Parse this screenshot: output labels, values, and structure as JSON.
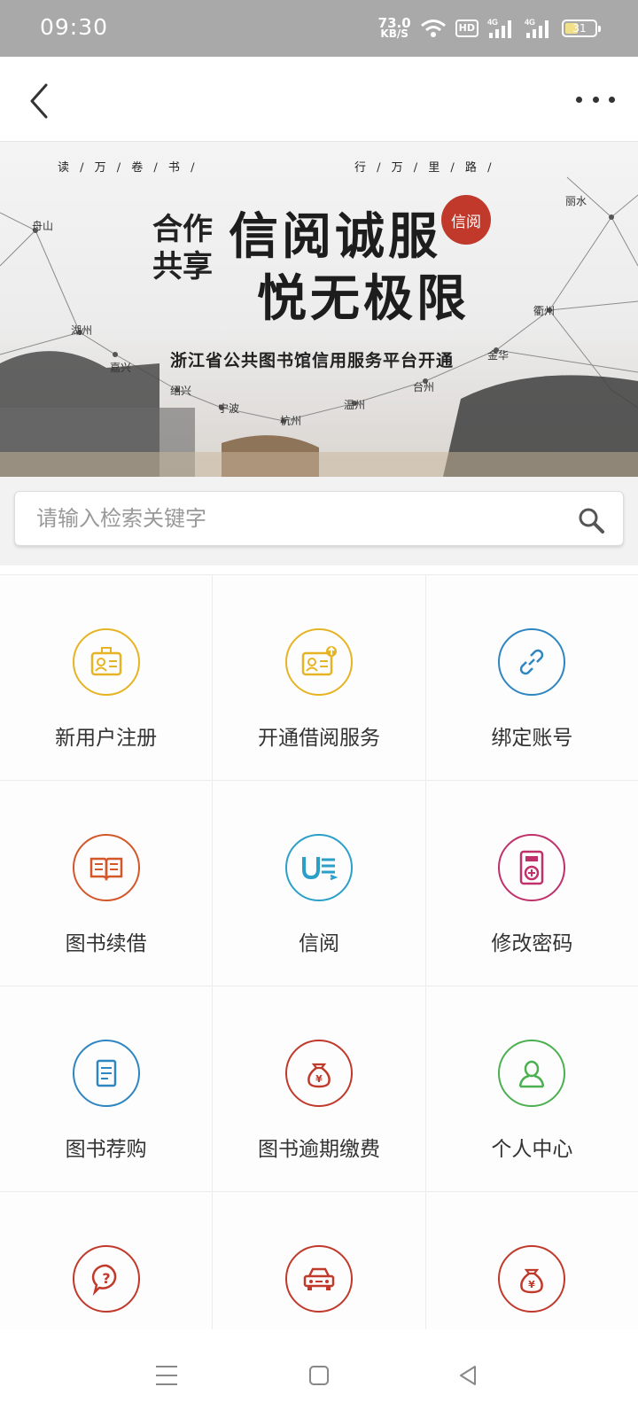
{
  "status_bar": {
    "time": "09:30",
    "net_speed_value": "73.0",
    "net_speed_unit": "KB/S",
    "hd_badge": "HD",
    "signal1": "4G",
    "signal2": "4G",
    "battery_level": "31"
  },
  "header": {
    "back_icon": "chevron-left-icon",
    "more_icon": "more-horizontal-icon"
  },
  "banner": {
    "top_left": "读 / 万 / 卷 / 书 /",
    "top_right": "行 / 万 / 里 / 路 /",
    "title_line1": "信阅诚服",
    "title_line2": "悦无极限",
    "left_mark_1": "合作",
    "left_mark_2": "共享",
    "seal_text": "信阅",
    "subtitle": "浙江省公共图书馆信用服务平台开通",
    "cities": [
      "舟山",
      "湖州",
      "嘉兴",
      "绍兴",
      "宁波",
      "杭州",
      "温州",
      "台州",
      "金华",
      "衢州",
      "丽水"
    ]
  },
  "search": {
    "placeholder": "请输入检索关键字",
    "value": ""
  },
  "grid": [
    {
      "label": "新用户注册",
      "icon": "id-card-icon",
      "color": "#e6b422"
    },
    {
      "label": "开通借阅服务",
      "icon": "id-card-upgrade-icon",
      "color": "#e6b422"
    },
    {
      "label": "绑定账号",
      "icon": "link-icon",
      "color": "#2e86c1"
    },
    {
      "label": "图书续借",
      "icon": "open-book-icon",
      "color": "#d4572a"
    },
    {
      "label": "信阅",
      "icon": "u-read-icon",
      "color": "#2aa0c8"
    },
    {
      "label": "修改密码",
      "icon": "keypad-icon",
      "color": "#c0306a"
    },
    {
      "label": "图书荐购",
      "icon": "book-recommend-icon",
      "color": "#2e86c1"
    },
    {
      "label": "图书逾期缴费",
      "icon": "money-bag-icon",
      "color": "#c0392b"
    },
    {
      "label": "个人中心",
      "icon": "user-icon",
      "color": "#4caf50"
    },
    {
      "label": "",
      "icon": "help-icon",
      "color": "#c0392b"
    },
    {
      "label": "",
      "icon": "car-icon",
      "color": "#c0392b"
    },
    {
      "label": "",
      "icon": "money-bag-icon",
      "color": "#c0392b"
    }
  ],
  "nav_bar": {
    "menu_icon": "menu-icon",
    "home_icon": "home-square-icon",
    "back_icon": "back-triangle-icon"
  }
}
